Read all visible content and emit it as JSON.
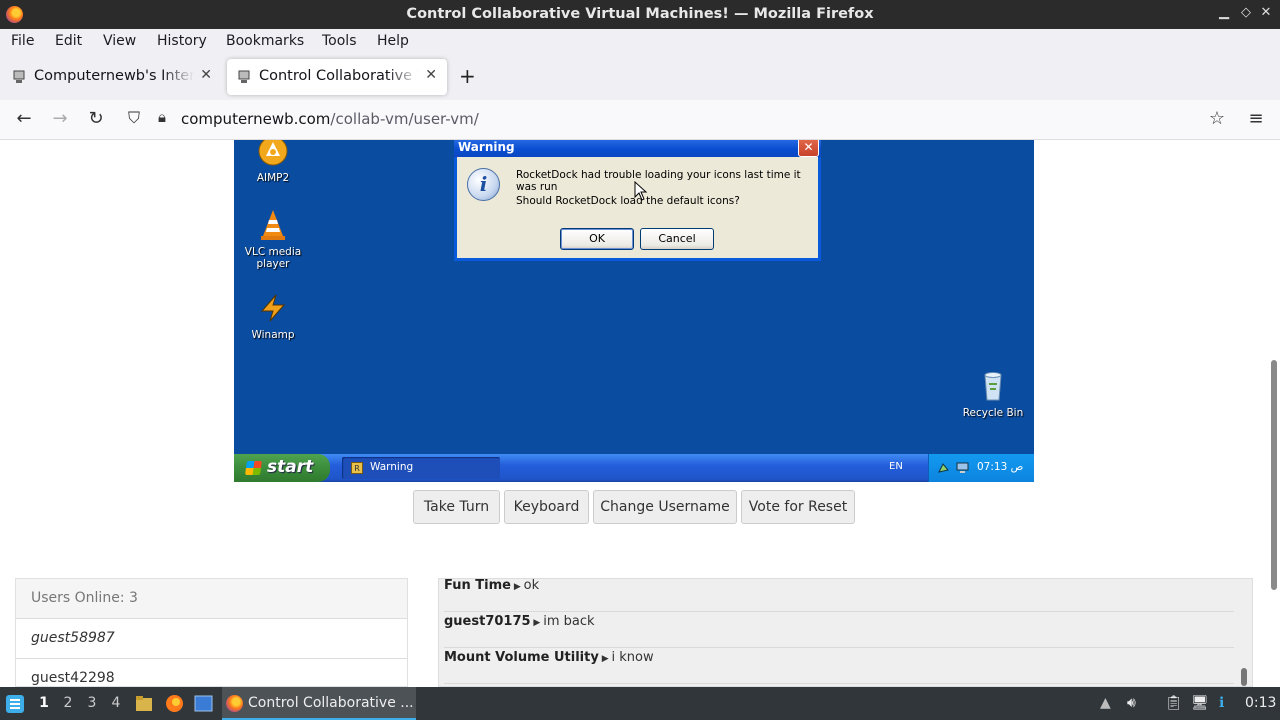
{
  "window": {
    "title": "Control Collaborative Virtual Machines! — Mozilla Firefox",
    "controls": [
      "minimize-icon",
      "maximize-icon",
      "close-icon"
    ]
  },
  "menubar": {
    "items": [
      "File",
      "Edit",
      "View",
      "History",
      "Bookmarks",
      "Tools",
      "Help"
    ]
  },
  "tabs": [
    {
      "label": "Computernewb's Internet",
      "active": false
    },
    {
      "label": "Control Collaborative Virtual Machines!",
      "active": true
    }
  ],
  "navbar": {
    "url_domain": "computernewb.com",
    "url_path": "/collab-vm/user-vm/"
  },
  "vm": {
    "desktop_icons": [
      {
        "label": "AIMP2",
        "icon": "aimp-icon"
      },
      {
        "label": "VLC media player",
        "icon": "vlc-cone-icon"
      },
      {
        "label": "Winamp",
        "icon": "winamp-icon"
      },
      {
        "label": "Recycle Bin",
        "icon": "recycle-bin-icon"
      }
    ],
    "dialog": {
      "title": "Warning",
      "line1": "RocketDock had trouble loading your icons last time it was run",
      "line2": "Should RocketDock load the default icons?",
      "ok_label": "OK",
      "cancel_label": "Cancel"
    },
    "taskbar": {
      "start_label": "start",
      "window_label": "Warning",
      "language": "EN",
      "clock": "07:13 ص"
    }
  },
  "vm_buttons": [
    "Take Turn",
    "Keyboard",
    "Change Username",
    "Vote for Reset"
  ],
  "users": {
    "header": "Users Online: 3",
    "list": [
      "guest58987",
      "guest42298"
    ]
  },
  "chat": [
    {
      "user": "Fun Time",
      "text": "ok"
    },
    {
      "user": "guest70175",
      "text": "im back"
    },
    {
      "user": "Mount Volume Utility",
      "text": "i know"
    }
  ],
  "os_panel": {
    "workspaces": [
      "1",
      "2",
      "3",
      "4"
    ],
    "task_label": "Control Collaborative ...",
    "clock": "0:13"
  },
  "colors": {
    "xp_desktop": "#0a4ca0",
    "xp_taskbar": "#245edb",
    "xp_start": "#3b8d3b",
    "panel": "#31363b",
    "panel_accent": "#3daee9"
  }
}
